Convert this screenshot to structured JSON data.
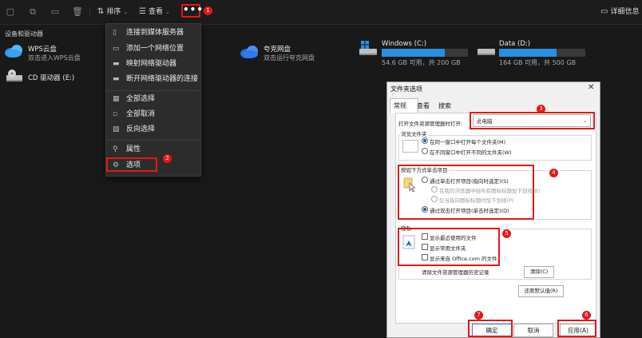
{
  "toolbar": {
    "sort_label": "排序",
    "view_label": "查看",
    "more_label": "•••",
    "details_label": "详细信息"
  },
  "sidebar_section": "设备和驱动器",
  "drives": {
    "wps": {
      "name": "WPS云盘",
      "sub": "双击进入WPS云盘"
    },
    "kuake": {
      "name": "夸克网盘",
      "sub": "双击运行夸克网盘"
    },
    "cdrom": {
      "name": "CD 驱动器 (E:)"
    },
    "c": {
      "name": "Windows (C:)",
      "sub": "54.6 GB 可用，共 200 GB",
      "used_fraction": 0.73
    },
    "d": {
      "name": "Data (D:)",
      "sub": "164 GB 可用，共 500 GB",
      "used_fraction": 0.67
    }
  },
  "menu": {
    "items": [
      {
        "label": "连接到媒体服务器"
      },
      {
        "label": "添加一个网络位置"
      },
      {
        "label": "映射网络驱动器"
      },
      {
        "label": "断开网络驱动器的连接"
      },
      {
        "label": "全部选择"
      },
      {
        "label": "全部取消"
      },
      {
        "label": "反向选择"
      },
      {
        "label": "属性"
      },
      {
        "label": "选项"
      }
    ]
  },
  "badges": [
    "1",
    "2",
    "3",
    "4",
    "5",
    "6",
    "7"
  ],
  "dialog": {
    "title": "文件夹选项",
    "close": "✕",
    "tabs": [
      "常规",
      "查看",
      "搜索"
    ],
    "open_explorer_label": "打开文件资源管理器时打开:",
    "open_explorer_value": "此电脑",
    "browse_group": "浏览文件夹",
    "browse_same": "在同一窗口中打开每个文件夹(M)",
    "browse_new": "在不同窗口中打开不同的文件夹(W)",
    "click_group": "按如下方式单击项目",
    "single_click": "通过单击打开项目(指向时选定)(S)",
    "underline_browser": "在我的浏览器中给所有图标标题加下划线(B)",
    "underline_point": "仅当指向图标标题时加下划线(P)",
    "double_click": "通过双击打开项目(单击时选定)(D)",
    "privacy_group": "隐私",
    "show_recent": "显示最近使用的文件",
    "show_frequent": "显示常用文件夹",
    "show_office": "显示来自 Office.com 的文件",
    "clear_label": "清除文件资源管理器历史记录",
    "clear_button": "清除(C)",
    "restore_button": "还原默认值(R)",
    "ok_button": "确定",
    "cancel_button": "取消",
    "apply_button": "应用(A)"
  }
}
